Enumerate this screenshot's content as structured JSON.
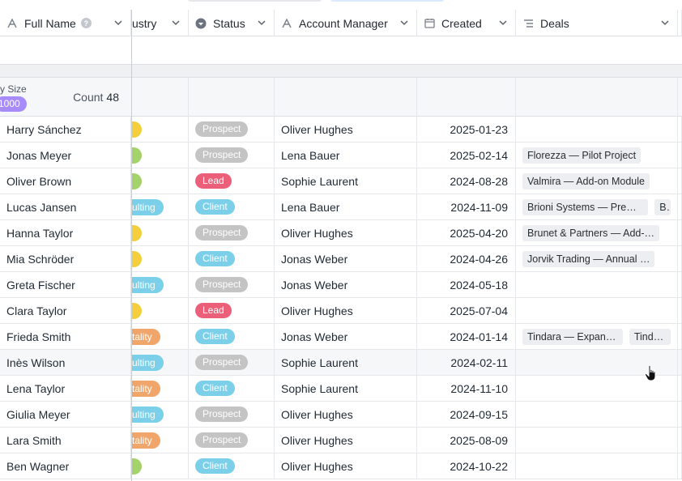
{
  "colors": {
    "prospect": "#c4c4c4",
    "lead": "#ec5f79",
    "client": "#7ccfe8",
    "industry_yellow": "#f4ce3c",
    "industry_green": "#a4d36b",
    "industry_consulting": "#7ccfe8",
    "industry_hospitality": "#f0a66a",
    "group_pill": "#a78bfa"
  },
  "columns": {
    "name": {
      "label": "Full Name",
      "icon": "text-a-icon",
      "help": "?"
    },
    "industry": {
      "label": "ustry"
    },
    "status": {
      "label": "Status",
      "icon": "status-icon"
    },
    "manager": {
      "label": "Account Manager",
      "icon": "text-a-icon"
    },
    "created": {
      "label": "Created",
      "icon": "calendar-icon"
    },
    "deals": {
      "label": "Deals",
      "icon": "link-list-icon"
    }
  },
  "group": {
    "label": "y Size",
    "pill": "1000",
    "count_label": "Count",
    "count_value": "48"
  },
  "rows": [
    {
      "name": "Harry Sánchez",
      "industry": "",
      "industry_color": "yellow",
      "status": "Prospect",
      "manager": "Oliver Hughes",
      "created": "2025-01-23",
      "deals": []
    },
    {
      "name": "Jonas Meyer",
      "industry": "",
      "industry_color": "green",
      "status": "Prospect",
      "manager": "Lena Bauer",
      "created": "2025-02-14",
      "deals": [
        "Florezza — Pilot Project"
      ]
    },
    {
      "name": "Oliver Brown",
      "industry": "",
      "industry_color": "green",
      "status": "Lead",
      "manager": "Sophie Laurent",
      "created": "2024-08-28",
      "deals": [
        "Valmira — Add-on Module"
      ]
    },
    {
      "name": "Lucas Jansen",
      "industry": "ulting",
      "industry_color": "consulting",
      "status": "Client",
      "manager": "Lena Bauer",
      "created": "2024-11-09",
      "deals": [
        "Brioni Systems — Premiu…",
        "B"
      ]
    },
    {
      "name": "Hanna Taylor",
      "industry": "",
      "industry_color": "yellow",
      "status": "Prospect",
      "manager": "Oliver Hughes",
      "created": "2025-04-20",
      "deals": [
        "Brunet & Partners — Add-…"
      ]
    },
    {
      "name": "Mia Schröder",
      "industry": "",
      "industry_color": "yellow",
      "status": "Client",
      "manager": "Jonas Weber",
      "created": "2024-04-26",
      "deals": [
        "Jorvik Trading — Annual …"
      ]
    },
    {
      "name": "Greta Fischer",
      "industry": "ulting",
      "industry_color": "consulting",
      "status": "Prospect",
      "manager": "Jonas Weber",
      "created": "2024-05-18",
      "deals": []
    },
    {
      "name": "Clara Taylor",
      "industry": "",
      "industry_color": "yellow",
      "status": "Lead",
      "manager": "Oliver Hughes",
      "created": "2025-07-04",
      "deals": []
    },
    {
      "name": "Frieda Smith",
      "industry": "tality",
      "industry_color": "hospitality",
      "status": "Client",
      "manager": "Jonas Weber",
      "created": "2024-01-14",
      "deals": [
        "Tindara — Expansion",
        "Tindara"
      ]
    },
    {
      "name": "Inès Wilson",
      "industry": "ulting",
      "industry_color": "consulting",
      "status": "Prospect",
      "manager": "Sophie Laurent",
      "created": "2024-02-11",
      "deals": []
    },
    {
      "name": "Lena Taylor",
      "industry": "tality",
      "industry_color": "hospitality",
      "status": "Client",
      "manager": "Sophie Laurent",
      "created": "2024-11-10",
      "deals": []
    },
    {
      "name": "Giulia Meyer",
      "industry": "ulting",
      "industry_color": "consulting",
      "status": "Prospect",
      "manager": "Oliver Hughes",
      "created": "2024-09-15",
      "deals": []
    },
    {
      "name": "Lara Smith",
      "industry": "tality",
      "industry_color": "hospitality",
      "status": "Prospect",
      "manager": "Oliver Hughes",
      "created": "2025-08-09",
      "deals": []
    },
    {
      "name": "Ben Wagner",
      "industry": "",
      "industry_color": "green",
      "status": "Client",
      "manager": "Oliver Hughes",
      "created": "2024-10-22",
      "deals": []
    }
  ]
}
